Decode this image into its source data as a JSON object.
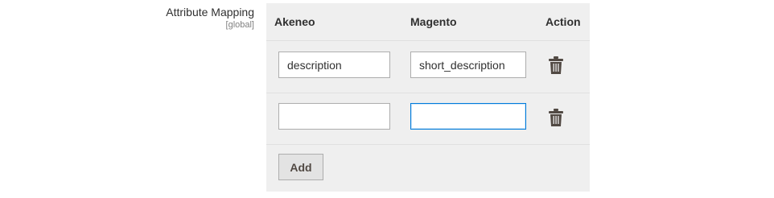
{
  "field": {
    "label": "Attribute Mapping",
    "scope": "[global]"
  },
  "table": {
    "headers": {
      "akeneo": "Akeneo",
      "magento": "Magento",
      "action": "Action"
    },
    "rows": [
      {
        "akeneo": "description",
        "magento": "short_description",
        "action_icon": "trash-icon"
      },
      {
        "akeneo": "",
        "magento": "",
        "action_icon": "trash-icon",
        "focused_field": "magento"
      }
    ],
    "add_label": "Add"
  },
  "colors": {
    "panel_bg": "#efefef",
    "focus_border": "#007bdb",
    "icon": "#514943"
  }
}
